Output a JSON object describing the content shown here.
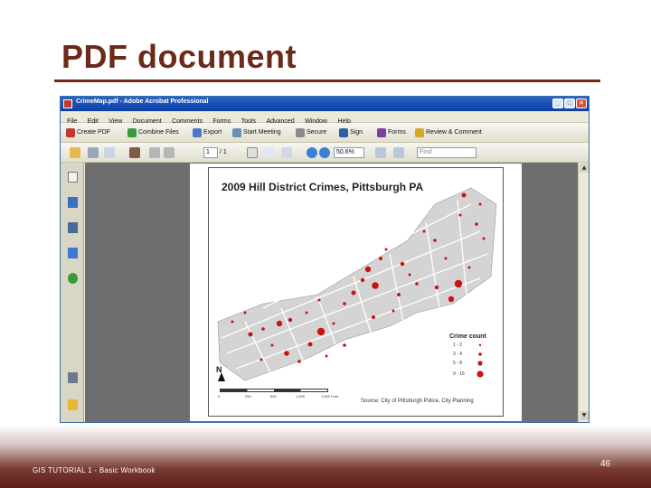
{
  "slide": {
    "title": "PDF document",
    "footer": "GIS TUTORIAL 1 - Basic Workbook",
    "page_number": "46"
  },
  "app": {
    "window_title": "CrimeMap.pdf - Adobe Acrobat Professional",
    "menu": [
      "File",
      "Edit",
      "View",
      "Document",
      "Comments",
      "Forms",
      "Tools",
      "Advanced",
      "Window",
      "Help"
    ],
    "toolbar1": {
      "create_pdf": "Create PDF",
      "combine_files": "Combine Files",
      "export": "Export",
      "start_meeting": "Start Meeting",
      "secure": "Secure",
      "sign": "Sign",
      "forms": "Forms",
      "review_comment": "Review & Comment"
    },
    "toolbar2": {
      "page_current": "1",
      "page_total": "/ 1",
      "zoom": "50.6%",
      "find_placeholder": "Find"
    }
  },
  "map": {
    "title": "2009 Hill District Crimes, Pittsburgh PA",
    "legend_title": "Crime count",
    "legend": [
      {
        "label": "1 - 2"
      },
      {
        "label": "3 - 4"
      },
      {
        "label": "5 - 8"
      },
      {
        "label": "9 - 16"
      }
    ],
    "north_label": "N",
    "scale_labels": [
      "0",
      "250",
      "500",
      "1,000",
      "1,500 Feet"
    ],
    "source": "Source: City of Pittsburgh Police, City Planning",
    "crime_color": "#cc1111"
  },
  "icons": {
    "nav": [
      "pages-icon",
      "attachments-page-icon",
      "layers-icon",
      "signatures-icon",
      "help-icon",
      "paperclip-icon",
      "comments-icon"
    ]
  }
}
